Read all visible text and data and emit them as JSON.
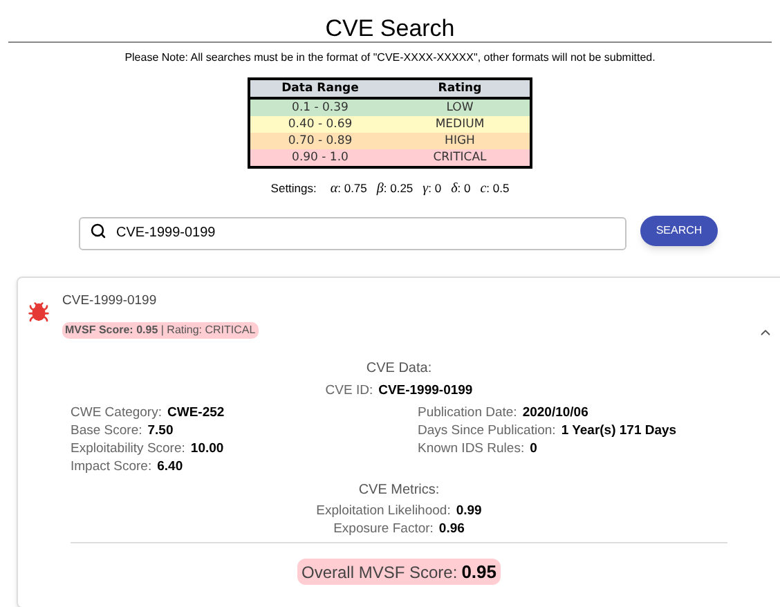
{
  "title": "CVE Search",
  "note": "Please Note: All searches must be in the format of \"CVE-XXXX-XXXXX\", other formats will not be submitted.",
  "rating_table": {
    "columns": [
      "Data Range",
      "Rating"
    ],
    "rows": [
      {
        "range": "0.1 - 0.39",
        "rating": "LOW",
        "color": "#c8e6c9"
      },
      {
        "range": "0.40 - 0.69",
        "rating": "MEDIUM",
        "color": "#fff9c4"
      },
      {
        "range": "0.70 - 0.89",
        "rating": "HIGH",
        "color": "#ffe0b2"
      },
      {
        "range": "0.90 - 1.0",
        "rating": "CRITICAL",
        "color": "#ffcdd2"
      }
    ]
  },
  "settings": {
    "label": "Settings:",
    "params": [
      {
        "symbol": "α",
        "value": ": 0.75"
      },
      {
        "symbol": "β",
        "value": ": 0.25"
      },
      {
        "symbol": "γ",
        "value": ": 0"
      },
      {
        "symbol": "δ",
        "value": ": 0"
      },
      {
        "symbol": "c",
        "value": ": 0.5"
      }
    ]
  },
  "search": {
    "value": "CVE-1999-0199",
    "button": "SEARCH"
  },
  "result": {
    "id": "CVE-1999-0199",
    "summary": "**MVSF Score: 0.95** | Rating: CRITICAL",
    "expanded": true,
    "data_title": "CVE Data:",
    "cve_id": {
      "label": "CVE ID:",
      "value": "CVE-1999-0199"
    },
    "left_fields": [
      {
        "label": "CWE Category:",
        "value": "CWE-252"
      },
      {
        "label": "Base Score:",
        "value": "7.50"
      },
      {
        "label": "Exploitability Score:",
        "value": "10.00"
      },
      {
        "label": "Impact Score:",
        "value": "6.40"
      }
    ],
    "right_fields": [
      {
        "label": "Publication Date:",
        "value": "2020/10/06"
      },
      {
        "label": "Days Since Publication:",
        "value": "1 Year(s) 171 Days"
      },
      {
        "label": "Known IDS Rules:",
        "value": "0"
      }
    ],
    "metrics_title": "CVE Metrics:",
    "metrics": [
      {
        "label": "Exploitation Likelihood:",
        "value": "0.99"
      },
      {
        "label": "Exposure Factor:",
        "value": "0.96"
      }
    ],
    "overall": {
      "label": "Overall MVSF Score:",
      "value": "0.95"
    }
  }
}
